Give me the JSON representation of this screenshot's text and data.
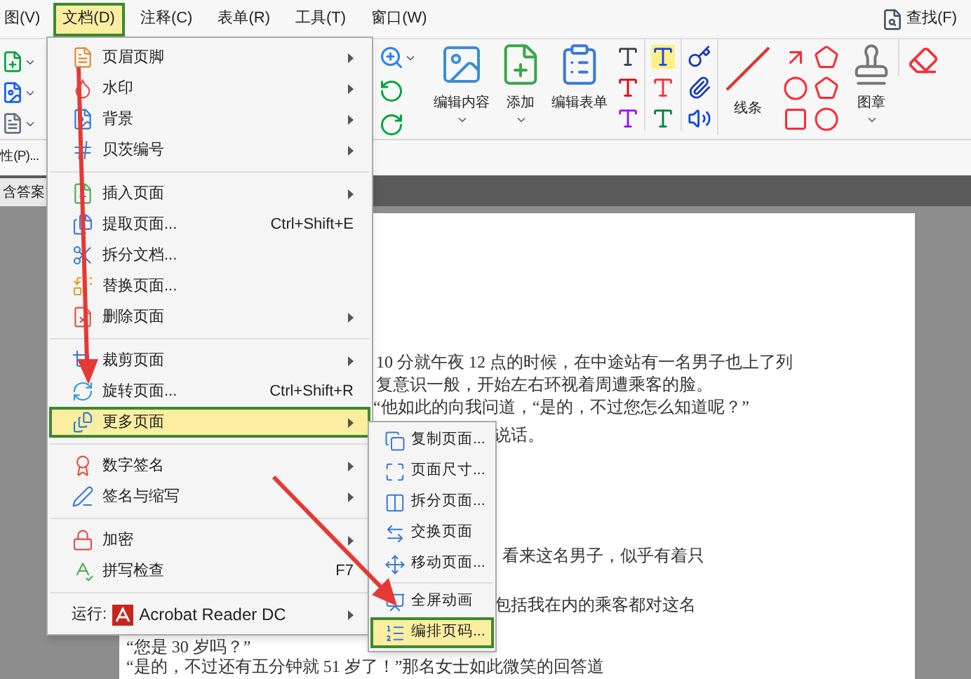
{
  "menu_bar": {
    "items": [
      {
        "label": "图(V)",
        "selected": false
      },
      {
        "label": "文档(D)",
        "selected": true
      },
      {
        "label": "注释(C)",
        "selected": false
      },
      {
        "label": "表单(R)",
        "selected": false
      },
      {
        "label": "工具(T)",
        "selected": false
      },
      {
        "label": "窗口(W)",
        "selected": false
      }
    ],
    "find_button": "查找(F)"
  },
  "toolbar": {
    "buttons": [
      {
        "label": "编辑内容"
      },
      {
        "label": "添加"
      },
      {
        "label": "编辑表单"
      },
      {
        "label": "线条"
      },
      {
        "label": "图章"
      }
    ]
  },
  "properties_button": "性(P)...",
  "document_tab": "含答案",
  "document": {
    "lines": [
      "10 分就午夜 12 点的时候，在中途站有一名男子也上了列",
      "复意识一般，开始左右环视着周遭乘客的脸。",
      "“他如此的向我问道，“是的，不过您怎么知道呢？”",
      "说话。",
      "看来这名男子，似乎有着只",
      "包括我在内的乘客都对这名",
      "“您是 30 岁吗？”",
      "“是的，不过还有五分钟就 51 岁了！”那名女士如此微笑的回答道"
    ]
  },
  "document_menu": {
    "items": [
      {
        "kind": "item",
        "label": "页眉页脚",
        "submenu": true,
        "selected": false
      },
      {
        "kind": "item",
        "label": "水印",
        "submenu": true,
        "selected": false
      },
      {
        "kind": "item",
        "label": "背景",
        "submenu": true,
        "selected": false
      },
      {
        "kind": "item",
        "label": "贝茨编号",
        "submenu": true,
        "selected": false
      },
      {
        "kind": "separator"
      },
      {
        "kind": "item",
        "label": "插入页面",
        "submenu": true,
        "selected": false
      },
      {
        "kind": "item",
        "label": "提取页面...",
        "shortcut": "Ctrl+Shift+E",
        "submenu": false,
        "selected": false
      },
      {
        "kind": "item",
        "label": "拆分文档...",
        "submenu": false,
        "selected": false
      },
      {
        "kind": "item",
        "label": "替换页面...",
        "submenu": false,
        "selected": false
      },
      {
        "kind": "item",
        "label": "删除页面",
        "submenu": true,
        "selected": false
      },
      {
        "kind": "separator"
      },
      {
        "kind": "item",
        "label": "裁剪页面",
        "submenu": true,
        "selected": false
      },
      {
        "kind": "item",
        "label": "旋转页面...",
        "shortcut": "Ctrl+Shift+R",
        "submenu": false,
        "selected": false
      },
      {
        "kind": "item",
        "label": "更多页面",
        "submenu": true,
        "selected": true
      },
      {
        "kind": "separator"
      },
      {
        "kind": "item",
        "label": "数字签名",
        "submenu": true,
        "selected": false
      },
      {
        "kind": "item",
        "label": "签名与缩写",
        "submenu": true,
        "selected": false
      },
      {
        "kind": "separator"
      },
      {
        "kind": "item",
        "label": "加密",
        "submenu": true,
        "selected": false
      },
      {
        "kind": "item",
        "label": "拼写检查",
        "shortcut": "F7",
        "submenu": false,
        "selected": false
      },
      {
        "kind": "separator"
      },
      {
        "kind": "run",
        "label": "运行:",
        "app": "Acrobat Reader DC",
        "submenu": true,
        "selected": false
      }
    ]
  },
  "more_pages_submenu": {
    "items": [
      {
        "kind": "item",
        "label": "复制页面...",
        "selected": false
      },
      {
        "kind": "item",
        "label": "页面尺寸...",
        "selected": false
      },
      {
        "kind": "item",
        "label": "拆分页面...",
        "selected": false
      },
      {
        "kind": "item",
        "label": "交换页面",
        "selected": false
      },
      {
        "kind": "item",
        "label": "移动页面...",
        "selected": false
      },
      {
        "kind": "separator"
      },
      {
        "kind": "item",
        "label": "全屏动画",
        "selected": false
      },
      {
        "kind": "item",
        "label": "编排页码...",
        "selected": true
      }
    ]
  }
}
